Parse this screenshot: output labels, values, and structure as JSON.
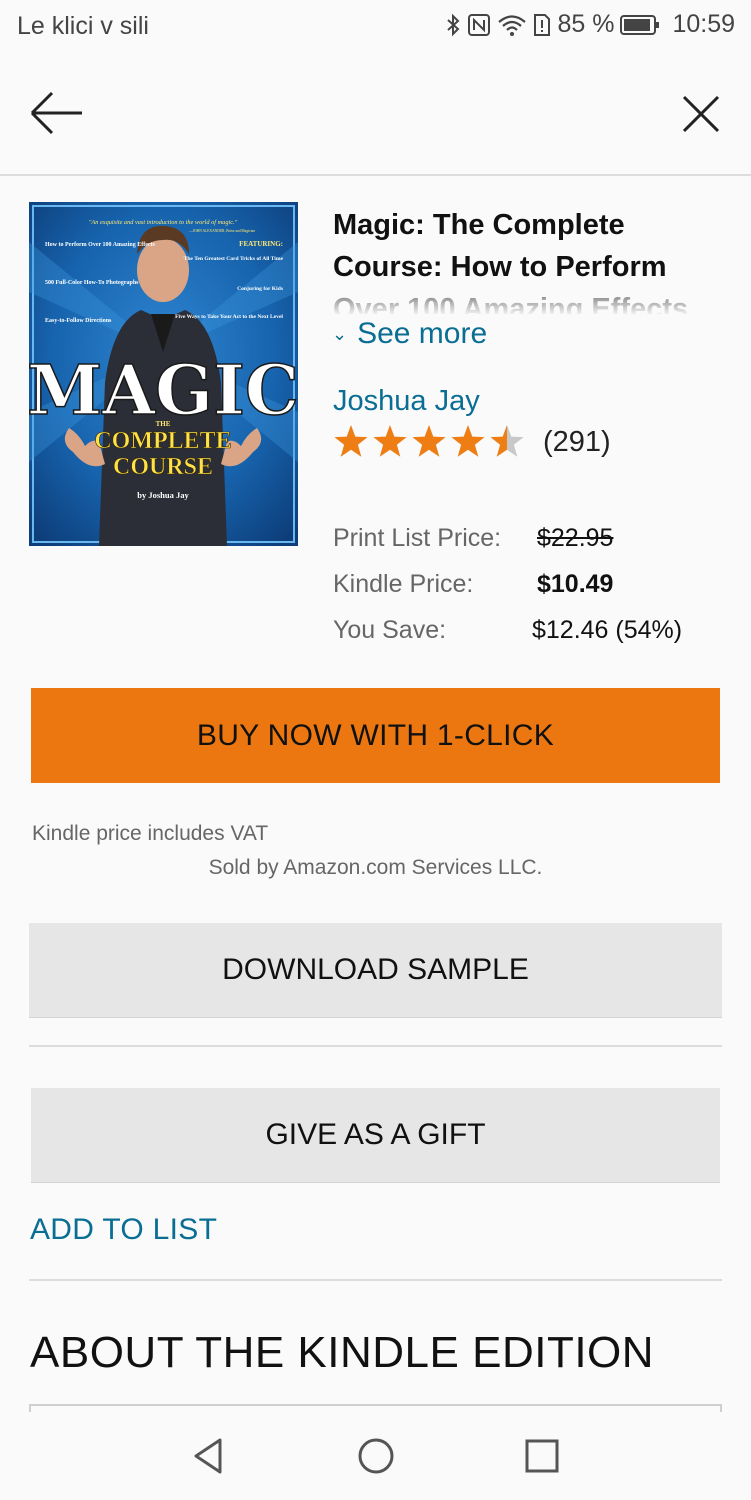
{
  "status_bar": {
    "carrier": "Le klici v sili",
    "battery_percent": "85 %",
    "time": "10:59",
    "icons": [
      "bluetooth-icon",
      "nfc-icon",
      "wifi-icon",
      "sim-alert-icon",
      "battery-icon"
    ]
  },
  "nav": {
    "back_icon": "arrow-left-icon",
    "close_icon": "close-icon"
  },
  "product": {
    "cover": {
      "tagline": "\"An exquisite and vast introduction to the world of magic.\"",
      "quote_by": "—JOHN ALEXANDER, Boise and Magician",
      "left_points": [
        "How to Perform Over 100 Amazing Effects",
        "500 Full-Color How-To Photographs",
        "Easy-to-Follow Directions"
      ],
      "featuring_label": "FEATURING:",
      "right_points": [
        "The Ten Greatest Card Tricks of All Time",
        "Conjuring for Kids",
        "Five Ways to Take Your Act to the Next Level"
      ],
      "big_title": "MAGIC",
      "the": "THE",
      "subtitle_line1": "COMPLETE",
      "subtitle_line2": "COURSE",
      "byline": "by Joshua Jay"
    },
    "title": "Magic: The Complete Course: How to Perform Over 100 Amazing Effects",
    "see_more": "See more",
    "author": "Joshua Jay",
    "rating": 4.5,
    "review_count": "(291)",
    "prices": {
      "print_list_label": "Print List Price:",
      "print_list_value": "$22.95",
      "kindle_label": "Kindle Price:",
      "kindle_value": "$10.49",
      "save_label": "You Save:",
      "save_value": "$12.46 (54%)"
    }
  },
  "actions": {
    "buy_now": "BUY NOW WITH 1-CLICK",
    "vat_note": "Kindle price includes VAT",
    "sold_by": "Sold by Amazon.com Services LLC.",
    "download_sample": "DOWNLOAD SAMPLE",
    "give_gift": "GIVE AS A GIFT",
    "add_to_list": "ADD TO LIST"
  },
  "about": {
    "heading": "ABOUT THE KINDLE EDITION"
  },
  "colors": {
    "buy_button": "#ec7711",
    "link": "#0a6e94",
    "star": "#ee7d14",
    "grey_button": "#e6e6e6"
  },
  "android_nav": [
    "back-triangle-icon",
    "home-circle-icon",
    "recents-square-icon"
  ]
}
